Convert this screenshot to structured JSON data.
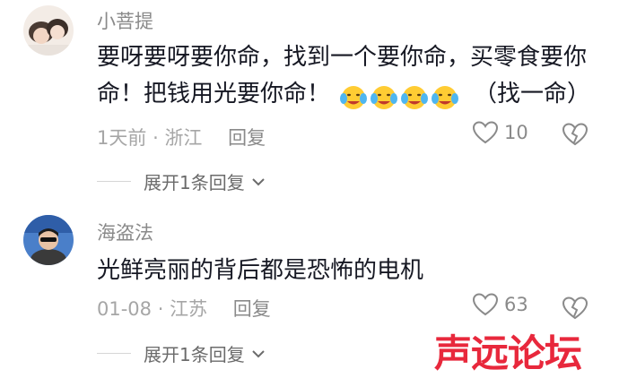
{
  "comments": [
    {
      "username": "小菩提",
      "text_line1": "要呀要呀要你命，找到一个要你命，买零食要你",
      "text_line2": "命！把钱用光要你命！",
      "text_tail": "（找一命）",
      "emoji_icon": "crying-face-emoji",
      "emoji_count": 4,
      "time": "1天前",
      "dot": "·",
      "location": "浙江",
      "reply_label": "回复",
      "like_count": "10",
      "expand_label": "展开1条回复"
    },
    {
      "username": "海盗法",
      "text_line1": "光鲜亮丽的背后都是恐怖的电机",
      "time": "01-08",
      "dot": "·",
      "location": "江苏",
      "reply_label": "回复",
      "like_count": "63",
      "expand_label": "展开1条回复"
    }
  ],
  "watermark": "声远论坛",
  "colors": {
    "watermark": "#e8283c",
    "text": "#161823",
    "meta": "#a6a6a6"
  }
}
